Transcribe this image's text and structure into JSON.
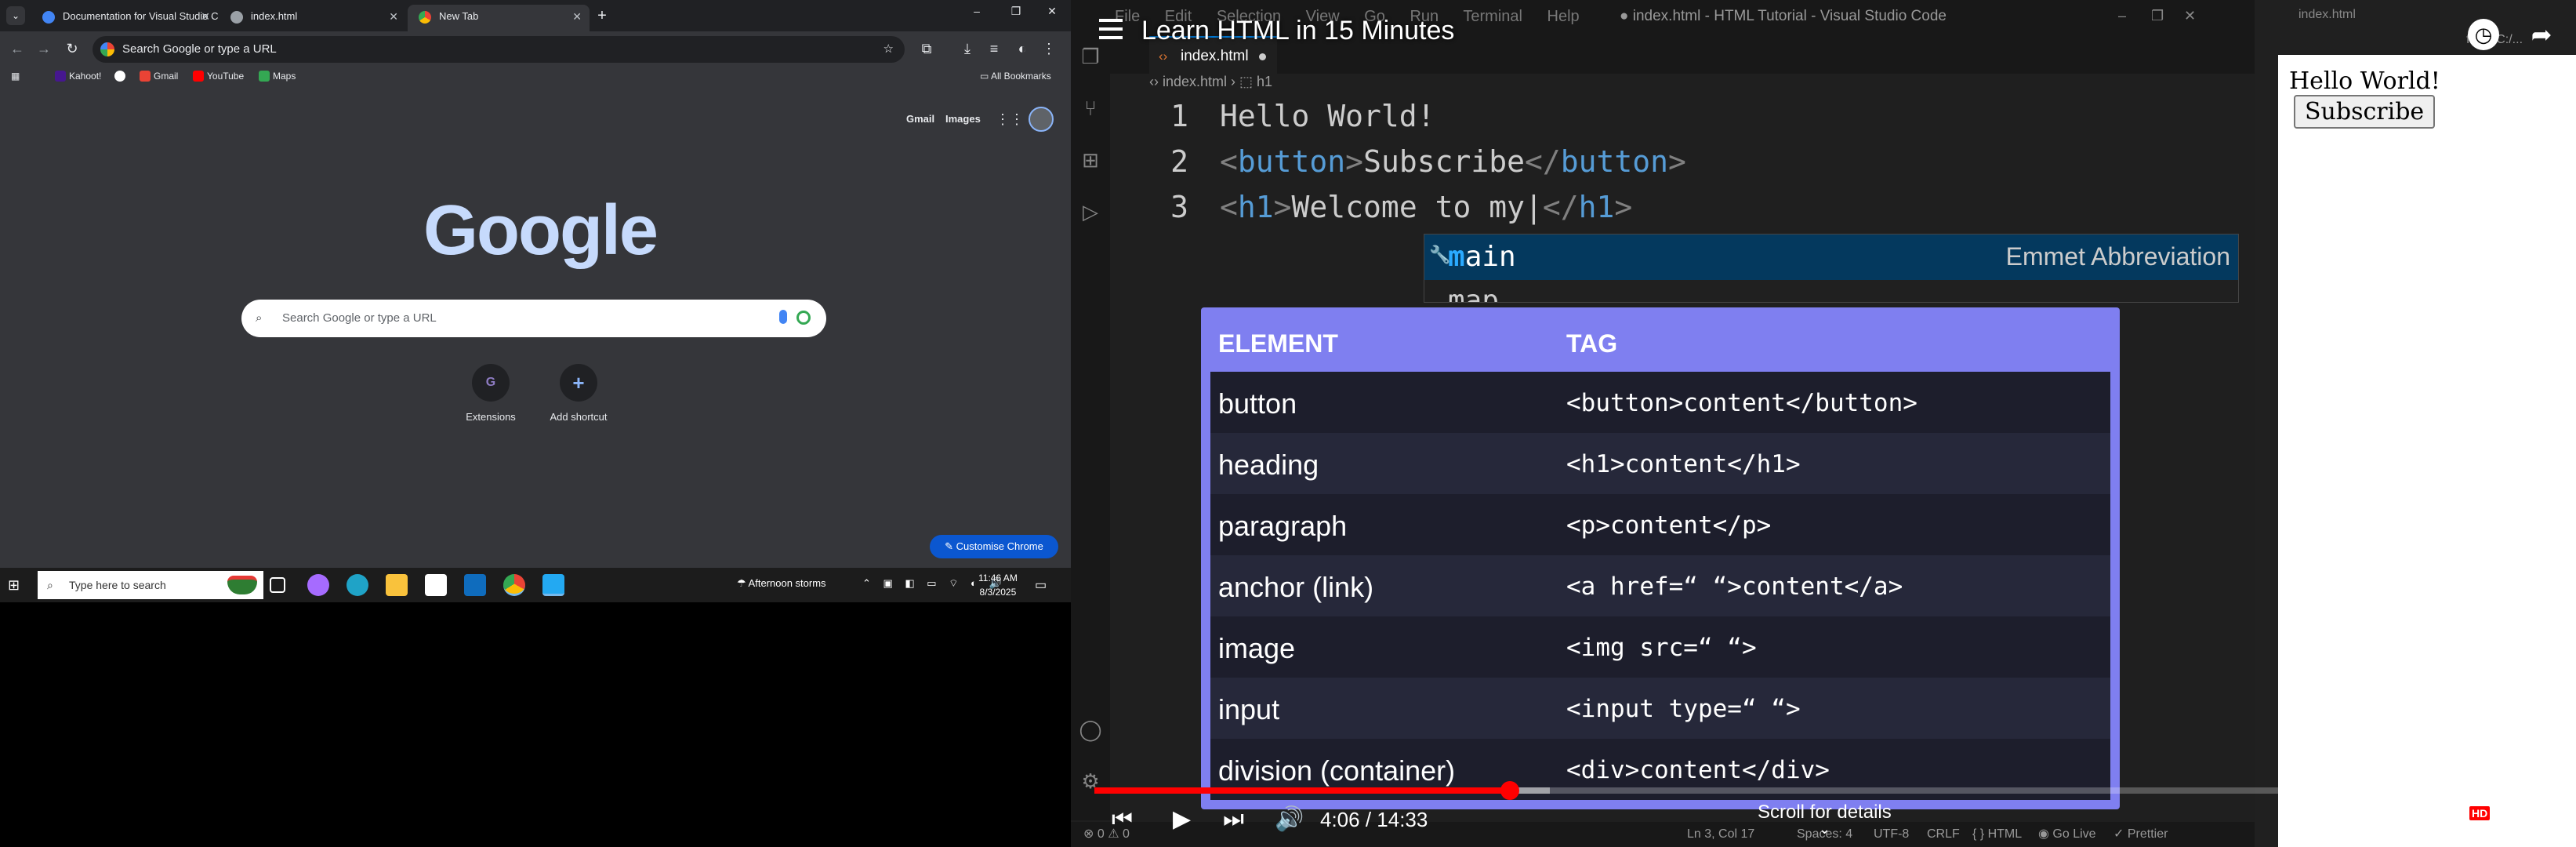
{
  "chrome": {
    "tabs": [
      {
        "title": "Documentation for Visual Studio Code"
      },
      {
        "title": "index.html"
      },
      {
        "title": "New Tab"
      }
    ],
    "tab_icons": {
      "menu": "chevron-down-icon",
      "close": "×",
      "new": "+"
    },
    "window_controls": {
      "minimize": "–",
      "maximize": "❐",
      "close": "✕"
    },
    "omnibox_text": "Search Google or type a URL",
    "bookmarks": [
      {
        "label": "Kahoot!",
        "color": "#46178f"
      },
      {
        "label": "",
        "color": "#ffffff"
      },
      {
        "label": "Gmail",
        "color": "#ea4335"
      },
      {
        "label": "YouTube",
        "color": "#ff0000"
      },
      {
        "label": "Maps",
        "color": "#34a853"
      }
    ],
    "all_bookmarks": "All Bookmarks",
    "ntp": {
      "gmail": "Gmail",
      "images": "Images",
      "logo": "Google",
      "search_placeholder": "Search Google or type a URL",
      "shortcuts": [
        {
          "label": "Extensions",
          "glyph": "G",
          "color": "#8e7cc3"
        },
        {
          "label": "Add shortcut",
          "glyph": "+",
          "color": "#8ab4f8"
        }
      ],
      "customise": "✎ Customise Chrome"
    }
  },
  "taskbar": {
    "search_text": "Type here to search",
    "weather": "☂ Afternoon storms",
    "tray": "⌃ ▣ ◧ ▭ ⌔ ◐ 🔊",
    "time": "11:46 AM",
    "date": "8/3/2025",
    "apps": [
      {
        "name": "task-view",
        "color": "#ffffff"
      },
      {
        "name": "copilot",
        "color": "#a66bff"
      },
      {
        "name": "edge",
        "color": "#1fa3c7"
      },
      {
        "name": "file-explorer",
        "color": "#f9c23c"
      },
      {
        "name": "store",
        "color": "#ffffff"
      },
      {
        "name": "outlook",
        "color": "#0f6cbd"
      },
      {
        "name": "chrome",
        "color": "#dd4b39"
      },
      {
        "name": "vscode",
        "color": "#23a9f2"
      }
    ]
  },
  "vscode": {
    "menu": [
      "File",
      "Edit",
      "Selection",
      "View",
      "Go",
      "Run",
      "Terminal",
      "Help"
    ],
    "window_title": "● index.html - HTML Tutorial - Visual Studio Code",
    "tab_label": "index.html",
    "breadcrumb": "‹› index.html › ⬚ h1",
    "lines": [
      {
        "num": "1",
        "text": "Hello World!"
      },
      {
        "num": "2",
        "open": "<",
        "tag": "button",
        "close": ">",
        "text": "Subscribe",
        "open2": "</",
        "tag2": "button",
        "close2": ">"
      },
      {
        "num": "3",
        "open": "<",
        "tag": "h1",
        "close": ">",
        "text": "Welcome to my|",
        "open2": "</",
        "tag2": "h1",
        "close2": ">"
      }
    ],
    "suggestion": {
      "match": "m",
      "rest": "ain",
      "type": "Emmet Abbreviation",
      "second": "map"
    },
    "status": {
      "problems": "⊗ 0 ⚠ 0",
      "position": "Ln 3, Col 17",
      "spaces": "Spaces: 4",
      "encoding": "UTF-8",
      "eol": "CRLF",
      "language": "{ } HTML",
      "golive": "◉ Go Live",
      "prettier": "✓ Prettier"
    }
  },
  "preview": {
    "tab_title": "index.html",
    "url": "file:///C:/...",
    "text": "Hello World!",
    "button": "Subscribe"
  },
  "cheatsheet": {
    "header_element": "ELEMENT",
    "header_tag": "TAG",
    "rows": [
      {
        "element": "button",
        "tag": "<button>content</button>"
      },
      {
        "element": "heading",
        "tag": "<h1>content</h1>"
      },
      {
        "element": "paragraph",
        "tag": "<p>content</p>"
      },
      {
        "element": "anchor (link)",
        "tag": "<a href=“ “>content</a>"
      },
      {
        "element": "image",
        "tag": "<img src=“ “>"
      },
      {
        "element": "input",
        "tag": "<input type=“ “>"
      },
      {
        "element": "division (container)",
        "tag": "<div>content</div>"
      }
    ]
  },
  "youtube": {
    "title": "Learn HTML in 15 Minutes",
    "current_time": "4:06",
    "duration": "14:33",
    "time_display": "4:06 / 14:33",
    "progress_fraction": 0.282,
    "buffered_fraction": 0.309,
    "scroll_hint": "Scroll for details",
    "hd_badge": "HD",
    "accent": "#ff0000"
  }
}
